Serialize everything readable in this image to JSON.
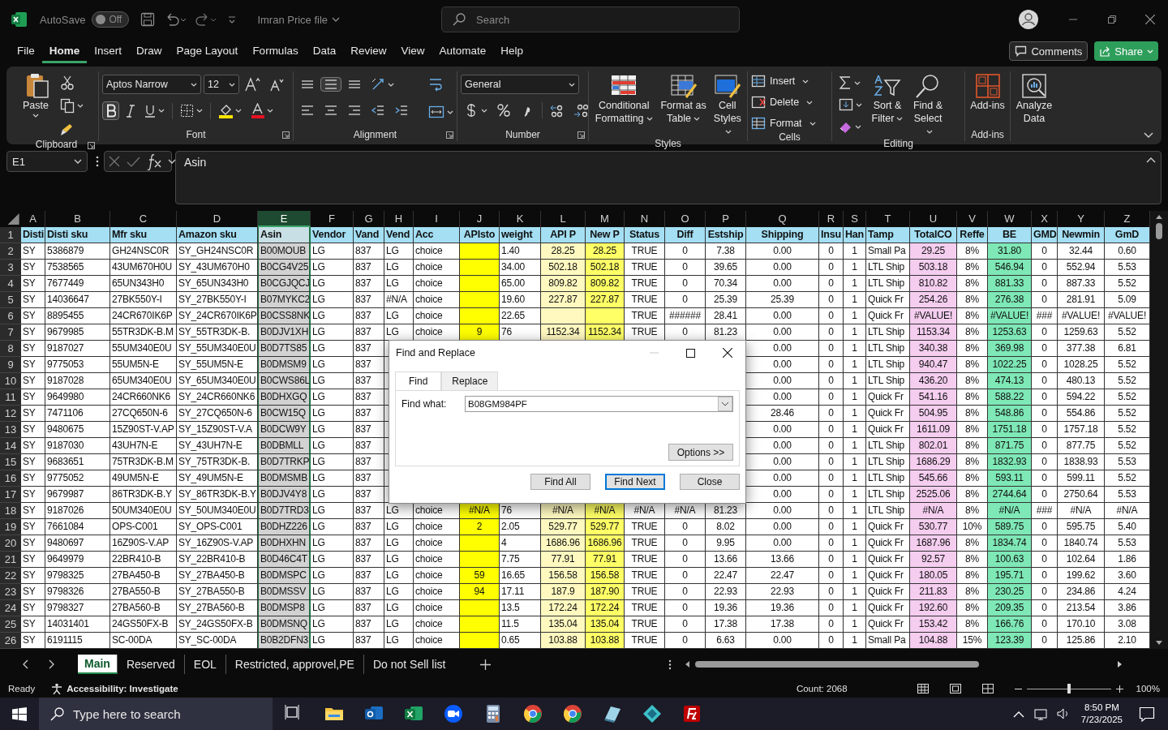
{
  "title_bar": {
    "autosave_label": "AutoSave",
    "autosave": {
      "on": false,
      "label": "Off"
    },
    "file_name": "Imran Price file",
    "search": {
      "placeholder": "Search"
    }
  },
  "menu": {
    "tabs": [
      {
        "label": "File",
        "selected": false
      },
      {
        "label": "Home",
        "selected": true
      },
      {
        "label": "Insert",
        "selected": false
      },
      {
        "label": "Draw",
        "selected": false
      },
      {
        "label": "Page Layout",
        "selected": false
      },
      {
        "label": "Formulas",
        "selected": false
      },
      {
        "label": "Data",
        "selected": false
      },
      {
        "label": "Review",
        "selected": false
      },
      {
        "label": "View",
        "selected": false
      },
      {
        "label": "Automate",
        "selected": false
      },
      {
        "label": "Help",
        "selected": false
      }
    ],
    "comments": "Comments",
    "share": "Share"
  },
  "ribbon": {
    "groups": [
      {
        "kind": "clipboard",
        "label": "Clipboard",
        "launcher": true,
        "buttons": [
          "Paste"
        ]
      },
      {
        "kind": "font",
        "label": "Font",
        "launcher": true,
        "font_name": "Aptos Narrow",
        "font_size": "12",
        "bold": true
      },
      {
        "kind": "alignment",
        "label": "Alignment",
        "launcher": true,
        "middle_align": true
      },
      {
        "kind": "number",
        "label": "Number",
        "launcher": true,
        "format": "General"
      },
      {
        "kind": "styles",
        "label": "Styles",
        "buttons": [
          "Conditional Formatting",
          "Format as Table",
          "Cell Styles"
        ]
      },
      {
        "kind": "cells",
        "label": "Cells",
        "buttons": [
          "Insert",
          "Delete",
          "Format"
        ]
      },
      {
        "kind": "editing",
        "label": "Editing",
        "buttons": [
          "Sort & Filter",
          "Find & Select"
        ]
      },
      {
        "kind": "addins",
        "label": "Add-ins",
        "buttons": [
          "Add-ins"
        ]
      },
      {
        "kind": "analyze",
        "buttons": [
          "Analyze Data"
        ]
      }
    ]
  },
  "formula_bar": {
    "name_box": "E1",
    "formula": "Asin"
  },
  "sheet": {
    "columns": [
      {
        "letter": "A",
        "kind": "text",
        "selected": false
      },
      {
        "letter": "B",
        "kind": "text",
        "selected": false
      },
      {
        "letter": "C",
        "kind": "text",
        "selected": false
      },
      {
        "letter": "D",
        "kind": "text",
        "selected": false
      },
      {
        "letter": "E",
        "kind": "text",
        "selected": true
      },
      {
        "letter": "F",
        "kind": "text",
        "selected": false
      },
      {
        "letter": "G",
        "kind": "text",
        "selected": false
      },
      {
        "letter": "H",
        "kind": "text",
        "selected": false
      },
      {
        "letter": "I",
        "kind": "text",
        "selected": false
      },
      {
        "letter": "J",
        "kind": "number",
        "selected": false,
        "color": "#ffff00"
      },
      {
        "letter": "K",
        "kind": "text",
        "selected": false
      },
      {
        "letter": "L",
        "kind": "number",
        "selected": false,
        "color": "#fff9c0"
      },
      {
        "letter": "M",
        "kind": "number",
        "selected": false,
        "color": "#ffff66"
      },
      {
        "letter": "N",
        "kind": "number",
        "selected": false
      },
      {
        "letter": "O",
        "kind": "number",
        "selected": false
      },
      {
        "letter": "P",
        "kind": "number",
        "selected": false
      },
      {
        "letter": "Q",
        "kind": "number",
        "selected": false
      },
      {
        "letter": "R",
        "kind": "number",
        "selected": false
      },
      {
        "letter": "S",
        "kind": "number",
        "selected": false
      },
      {
        "letter": "T",
        "kind": "text",
        "selected": false
      },
      {
        "letter": "U",
        "kind": "number",
        "selected": false,
        "color": "#f4cdef"
      },
      {
        "letter": "V",
        "kind": "number",
        "selected": false
      },
      {
        "letter": "W",
        "kind": "number",
        "selected": false,
        "color": "#7ee8b6"
      },
      {
        "letter": "X",
        "kind": "number",
        "selected": false
      },
      {
        "letter": "Y",
        "kind": "number",
        "selected": false
      },
      {
        "letter": "Z",
        "kind": "number",
        "selected": false
      }
    ],
    "rows": [
      {
        "number": "1",
        "kind": "header",
        "cells": [
          "Disti",
          "Disti sku",
          "Mfr sku",
          "Amazon sku",
          "Asin",
          "Vendor",
          "Vand",
          "Vend",
          "Acc",
          "APIsto",
          "weight",
          "API P",
          "New P",
          "Status",
          "Diff",
          "Estship",
          "Shipping",
          "Insu",
          "Han",
          "Tamp",
          "TotalCO",
          "Reffe",
          "BE",
          "GMD",
          "Newmin",
          "GmD"
        ]
      },
      {
        "number": "2",
        "kind": "data",
        "cells": [
          "SY",
          "5386879",
          "GH24NSC0R",
          "SY_GH24NSC0R",
          "B00MOUB",
          "LG",
          "837",
          "LG",
          "choice",
          null,
          "1.40",
          "28.25",
          "28.25",
          "TRUE",
          "0",
          "7.38",
          "0.00",
          "0",
          "1",
          "Small Pa",
          "29.25",
          "8%",
          "31.80",
          "0",
          "32.44",
          "0.60"
        ]
      },
      {
        "number": "3",
        "kind": "data",
        "cells": [
          "SY",
          "7538565",
          "43UM670H0U",
          "SY_43UM670H0",
          "B0CG4V25",
          "LG",
          "837",
          "LG",
          "choice",
          null,
          "34.00",
          "502.18",
          "502.18",
          "TRUE",
          "0",
          "39.65",
          "0.00",
          "0",
          "1",
          "LTL Ship",
          "503.18",
          "8%",
          "546.94",
          "0",
          "552.94",
          "5.53"
        ]
      },
      {
        "number": "4",
        "kind": "data",
        "cells": [
          "SY",
          "7677449",
          "65UN343H0",
          "SY_65UN343H0",
          "B0CGJQCJ",
          "LG",
          "837",
          "LG",
          "choice",
          null,
          "65.00",
          "809.82",
          "809.82",
          "TRUE",
          "0",
          "70.34",
          "0.00",
          "0",
          "1",
          "LTL Ship",
          "810.82",
          "8%",
          "881.33",
          "0",
          "887.33",
          "5.52"
        ]
      },
      {
        "number": "5",
        "kind": "data",
        "cells": [
          "SY",
          "14036647",
          "27BK550Y-I",
          "SY_27BK550Y-I",
          "B07MYKC2",
          "LG",
          "837",
          "#N/A",
          "choice",
          null,
          "19.60",
          "227.87",
          "227.87",
          "TRUE",
          "0",
          "25.39",
          "25.39",
          "0",
          "1",
          "Quick Fr",
          "254.26",
          "8%",
          "276.38",
          "0",
          "281.91",
          "5.09"
        ]
      },
      {
        "number": "6",
        "kind": "data",
        "cells": [
          "SY",
          "8895455",
          "24CR670IK6P",
          "SY_24CR670IK6P",
          "B0CSS8NK",
          "LG",
          "837",
          "LG",
          "choice",
          null,
          "22.65",
          null,
          null,
          "TRUE",
          "######",
          "28.41",
          "0.00",
          "0",
          "1",
          "Quick Fr",
          "#VALUE!",
          "8%",
          "#VALUE!",
          "###",
          "#VALUE!",
          "#VALUE!"
        ]
      },
      {
        "number": "7",
        "kind": "data",
        "cells": [
          "SY",
          "9679985",
          "55TR3DK-B.M",
          "SY_55TR3DK-B.",
          "B0DJV1XH",
          "LG",
          "837",
          "LG",
          "choice",
          "9",
          "76",
          "1152.34",
          "1152.34",
          "TRUE",
          "0",
          "81.23",
          "0.00",
          "0",
          "1",
          "LTL Ship",
          "1153.34",
          "8%",
          "1253.63",
          "0",
          "1259.63",
          "5.52"
        ]
      },
      {
        "number": "8",
        "kind": "data",
        "cells": [
          "SY",
          "9187027",
          "55UM340E0U",
          "SY_55UM340E0U",
          "B0D7TS85",
          "LG",
          "837",
          null,
          null,
          null,
          null,
          null,
          null,
          null,
          null,
          null,
          "0.00",
          "0",
          "1",
          "LTL Ship",
          "340.38",
          "8%",
          "369.98",
          "0",
          "377.38",
          "6.81"
        ]
      },
      {
        "number": "9",
        "kind": "data",
        "cells": [
          "SY",
          "9775053",
          "55UM5N-E",
          "SY_55UM5N-E",
          "B0DMSM9",
          "LG",
          "837",
          null,
          null,
          null,
          null,
          null,
          null,
          null,
          null,
          null,
          "0.00",
          "0",
          "1",
          "LTL Ship",
          "940.47",
          "8%",
          "1022.25",
          "0",
          "1028.25",
          "5.52"
        ]
      },
      {
        "number": "10",
        "kind": "data",
        "cells": [
          "SY",
          "9187028",
          "65UM340E0U",
          "SY_65UM340E0U",
          "B0CWS86L",
          "LG",
          "837",
          null,
          null,
          null,
          null,
          null,
          null,
          null,
          null,
          null,
          "0.00",
          "0",
          "1",
          "LTL Ship",
          "436.20",
          "8%",
          "474.13",
          "0",
          "480.13",
          "5.52"
        ]
      },
      {
        "number": "11",
        "kind": "data",
        "cells": [
          "SY",
          "9649980",
          "24CR660NK6",
          "SY_24CR660NK6",
          "B0DHXGQ",
          "LG",
          "837",
          null,
          null,
          null,
          null,
          null,
          null,
          null,
          null,
          null,
          "0.00",
          "0",
          "1",
          "Quick Fr",
          "541.16",
          "8%",
          "588.22",
          "0",
          "594.22",
          "5.52"
        ]
      },
      {
        "number": "12",
        "kind": "data",
        "cells": [
          "SY",
          "7471106",
          "27CQ650N-6",
          "SY_27CQ650N-6",
          "B0CW15Q",
          "LG",
          "837",
          null,
          null,
          null,
          null,
          null,
          null,
          null,
          null,
          null,
          "28.46",
          "0",
          "1",
          "Quick Fr",
          "504.95",
          "8%",
          "548.86",
          "0",
          "554.86",
          "5.52"
        ]
      },
      {
        "number": "13",
        "kind": "data",
        "cells": [
          "SY",
          "9480675",
          "15Z90ST-V.AP",
          "SY_15Z90ST-V.A",
          "B0DCW9Y",
          "LG",
          "837",
          null,
          null,
          null,
          null,
          null,
          null,
          null,
          null,
          null,
          "0.00",
          "0",
          "1",
          "Quick Fr",
          "1611.09",
          "8%",
          "1751.18",
          "0",
          "1757.18",
          "5.52"
        ]
      },
      {
        "number": "14",
        "kind": "data",
        "cells": [
          "SY",
          "9187030",
          "43UH7N-E",
          "SY_43UH7N-E",
          "B0DBMLL",
          "LG",
          "837",
          null,
          null,
          null,
          null,
          null,
          null,
          null,
          null,
          null,
          "0.00",
          "0",
          "1",
          "LTL Ship",
          "802.01",
          "8%",
          "871.75",
          "0",
          "877.75",
          "5.52"
        ]
      },
      {
        "number": "15",
        "kind": "data",
        "cells": [
          "SY",
          "9683651",
          "75TR3DK-B.M",
          "SY_75TR3DK-B.",
          "B0D7TRKP",
          "LG",
          "837",
          null,
          null,
          null,
          null,
          null,
          null,
          null,
          null,
          null,
          "0.00",
          "0",
          "1",
          "LTL Ship",
          "1686.29",
          "8%",
          "1832.93",
          "0",
          "1838.93",
          "5.53"
        ]
      },
      {
        "number": "16",
        "kind": "data",
        "cells": [
          "SY",
          "9775052",
          "49UM5N-E",
          "SY_49UM5N-E",
          "B0DMSMB",
          "LG",
          "837",
          null,
          null,
          null,
          null,
          null,
          null,
          null,
          null,
          null,
          "0.00",
          "0",
          "1",
          "LTL Ship",
          "545.66",
          "8%",
          "593.11",
          "0",
          "599.11",
          "5.52"
        ]
      },
      {
        "number": "17",
        "kind": "data",
        "cells": [
          "SY",
          "9679987",
          "86TR3DK-B.Y",
          "SY_86TR3DK-B.Y",
          "B0DJV4Y8",
          "LG",
          "837",
          null,
          null,
          null,
          null,
          null,
          null,
          null,
          null,
          null,
          "0.00",
          "0",
          "1",
          "LTL Ship",
          "2525.06",
          "8%",
          "2744.64",
          "0",
          "2750.64",
          "5.53"
        ]
      },
      {
        "number": "18",
        "kind": "data",
        "cells": [
          "SY",
          "9187026",
          "50UM340E0U",
          "SY_50UM340E0U",
          "B0D7TRD3",
          "LG",
          "837",
          "LG",
          "choice",
          "#N/A",
          "76",
          "#N/A",
          "#N/A",
          "#N/A",
          "#N/A",
          "81.23",
          "0.00",
          "0",
          "1",
          "LTL Ship",
          "#N/A",
          "8%",
          "#N/A",
          "###",
          "#N/A",
          "#N/A"
        ]
      },
      {
        "number": "19",
        "kind": "data",
        "cells": [
          "SY",
          "7661084",
          "OPS-C001",
          "SY_OPS-C001",
          "B0DHZ226",
          "LG",
          "837",
          "LG",
          "choice",
          "2",
          "2.05",
          "529.77",
          "529.77",
          "TRUE",
          "0",
          "8.02",
          "0.00",
          "0",
          "1",
          "Quick Fr",
          "530.77",
          "10%",
          "589.75",
          "0",
          "595.75",
          "5.40"
        ]
      },
      {
        "number": "20",
        "kind": "data",
        "cells": [
          "SY",
          "9480697",
          "16Z90S-V.AP",
          "SY_16Z90S-V.AP",
          "B0DHXHN",
          "LG",
          "837",
          "LG",
          "choice",
          null,
          "4",
          "1686.96",
          "1686.96",
          "TRUE",
          "0",
          "9.95",
          "0.00",
          "0",
          "1",
          "Quick Fr",
          "1687.96",
          "8%",
          "1834.74",
          "0",
          "1840.74",
          "5.53"
        ]
      },
      {
        "number": "21",
        "kind": "data",
        "cells": [
          "SY",
          "9649979",
          "22BR410-B",
          "SY_22BR410-B",
          "B0D46C4T",
          "LG",
          "837",
          "LG",
          "choice",
          null,
          "7.75",
          "77.91",
          "77.91",
          "TRUE",
          "0",
          "13.66",
          "13.66",
          "0",
          "1",
          "Quick Fr",
          "92.57",
          "8%",
          "100.63",
          "0",
          "102.64",
          "1.86"
        ]
      },
      {
        "number": "22",
        "kind": "data",
        "cells": [
          "SY",
          "9798325",
          "27BA450-B",
          "SY_27BA450-B",
          "B0DMSPC",
          "LG",
          "837",
          "LG",
          "choice",
          "59",
          "16.65",
          "156.58",
          "156.58",
          "TRUE",
          "0",
          "22.47",
          "22.47",
          "0",
          "1",
          "Quick Fr",
          "180.05",
          "8%",
          "195.71",
          "0",
          "199.62",
          "3.60"
        ]
      },
      {
        "number": "23",
        "kind": "data",
        "cells": [
          "SY",
          "9798326",
          "27BA550-B",
          "SY_27BA550-B",
          "B0DMSSV",
          "LG",
          "837",
          "LG",
          "choice",
          "94",
          "17.11",
          "187.9",
          "187.90",
          "TRUE",
          "0",
          "22.93",
          "22.93",
          "0",
          "1",
          "Quick Fr",
          "211.83",
          "8%",
          "230.25",
          "0",
          "234.86",
          "4.24"
        ]
      },
      {
        "number": "24",
        "kind": "data",
        "cells": [
          "SY",
          "9798327",
          "27BA560-B",
          "SY_27BA560-B",
          "B0DMSP8",
          "LG",
          "837",
          "LG",
          "choice",
          null,
          "13.5",
          "172.24",
          "172.24",
          "TRUE",
          "0",
          "19.36",
          "19.36",
          "0",
          "1",
          "Quick Fr",
          "192.60",
          "8%",
          "209.35",
          "0",
          "213.54",
          "3.86"
        ]
      },
      {
        "number": "25",
        "kind": "data",
        "cells": [
          "SY",
          "14031401",
          "24GS50FX-B",
          "SY_24GS50FX-B",
          "B0DMSNQ",
          "LG",
          "837",
          "LG",
          "choice",
          null,
          "11.5",
          "135.04",
          "135.04",
          "TRUE",
          "0",
          "17.38",
          "17.38",
          "0",
          "1",
          "Quick Fr",
          "153.42",
          "8%",
          "166.76",
          "0",
          "170.10",
          "3.08"
        ]
      },
      {
        "number": "26",
        "kind": "data",
        "cells": [
          "SY",
          "6191115",
          "SC-00DA",
          "SY_SC-00DA",
          "B0B2DFN3",
          "LG",
          "837",
          "LG",
          "choice",
          null,
          "0.65",
          "103.88",
          "103.88",
          "TRUE",
          "0",
          "6.63",
          "0.00",
          "0",
          "1",
          "Small Pa",
          "104.88",
          "15%",
          "123.39",
          "0",
          "125.86",
          "2.10"
        ]
      }
    ]
  },
  "dialog": {
    "title": "Find and Replace",
    "tabs": [
      {
        "label": "Find",
        "selected": true
      },
      {
        "label": "Replace",
        "selected": false
      }
    ],
    "find_label": "Find what:",
    "find_value": "B08GM984PF",
    "options": "Options >>",
    "buttons": [
      {
        "label": "Find All",
        "default": false
      },
      {
        "label": "Find Next",
        "default": true
      },
      {
        "label": "Close",
        "default": false
      }
    ]
  },
  "sheet_tabs": {
    "tabs": [
      {
        "label": "Main",
        "selected": true
      },
      {
        "label": "Reserved",
        "selected": false
      },
      {
        "label": "EOL",
        "selected": false
      },
      {
        "label": "Restricted, approvel,PE",
        "selected": false
      },
      {
        "label": "Do not Sell list",
        "selected": false
      }
    ]
  },
  "status_bar": {
    "mode": "Ready",
    "accessibility": "Accessibility: Investigate",
    "count": "Count: 2068",
    "zoom": {
      "level": 0.5,
      "label": "100%"
    }
  },
  "taskbar": {
    "search_placeholder": "Type here to search",
    "time": "8:50 PM",
    "date": "7/23/2025"
  }
}
